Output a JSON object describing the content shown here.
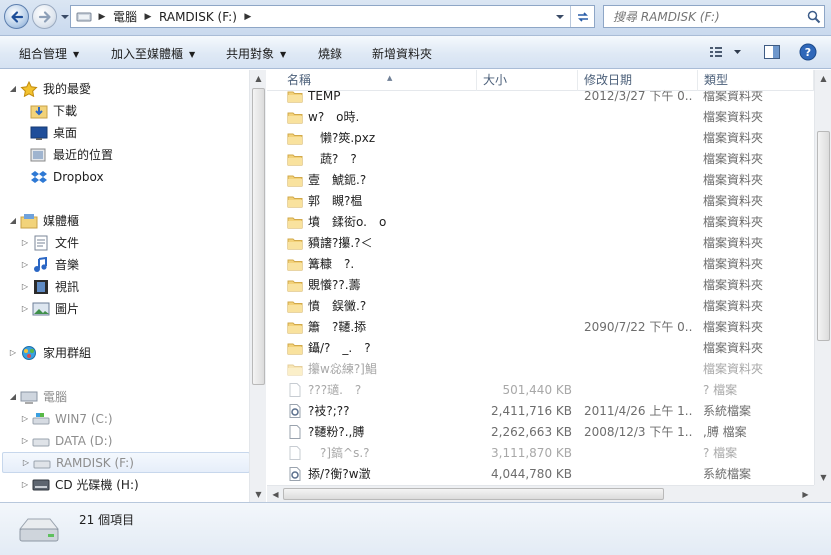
{
  "address": {
    "breadcrumbs": [
      "電腦",
      "RAMDISK (F:)"
    ],
    "search_placeholder": "搜尋 RAMDISK (F:)"
  },
  "toolbar": {
    "organize": "組合管理",
    "add_to_library": "加入至媒體櫃",
    "share_with": "共用對象",
    "burn": "燒錄",
    "new_folder": "新增資料夾"
  },
  "nav": {
    "favorites": {
      "label": "我的最愛",
      "items": [
        "下載",
        "桌面",
        "最近的位置",
        "Dropbox"
      ]
    },
    "libraries": {
      "label": "媒體櫃",
      "items": [
        "文件",
        "音樂",
        "視訊",
        "圖片"
      ]
    },
    "homegroup": {
      "label": "家用群組"
    },
    "computer": {
      "label": "電腦",
      "drives": [
        "WIN7 (C:)",
        "DATA (D:)",
        "RAMDISK (F:)",
        "CD 光碟機 (H:)"
      ]
    }
  },
  "columns": {
    "name": "名稱",
    "size": "大小",
    "date": "修改日期",
    "type": "類型"
  },
  "files": [
    {
      "name": "TEMP",
      "size": "",
      "date": "2012/3/27 下午 0...",
      "type": "檔案資料夾",
      "kind": "folder"
    },
    {
      "name": "w?　o時.",
      "size": "",
      "date": "",
      "type": "檔案資料夾",
      "kind": "folder"
    },
    {
      "name": "　懒?筴.pxz",
      "size": "",
      "date": "",
      "type": "檔案資料夾",
      "kind": "folder"
    },
    {
      "name": "　蔬?　?",
      "size": "",
      "date": "",
      "type": "檔案資料夾",
      "kind": "folder"
    },
    {
      "name": "壹　鯱鈪.?",
      "size": "",
      "date": "",
      "type": "檔案資料夾",
      "kind": "folder"
    },
    {
      "name": "郭　瞡?榅",
      "size": "",
      "date": "",
      "type": "檔案資料夾",
      "kind": "folder"
    },
    {
      "name": "墳　鍒衒o.　o",
      "size": "",
      "date": "",
      "type": "檔案資料夾",
      "kind": "folder"
    },
    {
      "name": "豶譇?攥.?＜",
      "size": "",
      "date": "",
      "type": "檔案資料夾",
      "kind": "folder"
    },
    {
      "name": "篝糠　?.",
      "size": "",
      "date": "",
      "type": "檔案資料夾",
      "kind": "folder"
    },
    {
      "name": "覞懩??.薵",
      "size": "",
      "date": "",
      "type": "檔案資料夾",
      "kind": "folder"
    },
    {
      "name": "憤　鋘黴.?",
      "size": "",
      "date": "",
      "type": "檔案資料夾",
      "kind": "folder"
    },
    {
      "name": "簫　?韆.掭",
      "size": "",
      "date": "2090/7/22 下午 0...",
      "type": "檔案資料夾",
      "kind": "folder"
    },
    {
      "name": "鑷/?　_.　?",
      "size": "",
      "date": "",
      "type": "檔案資料夾",
      "kind": "folder"
    },
    {
      "name": "攥w惢練?]鯧",
      "size": "",
      "date": "",
      "type": "檔案資料夾",
      "kind": "folder",
      "faded": true
    },
    {
      "name": "???瓋.　?",
      "size": "501,440 KB",
      "date": "",
      "type": "? 檔案",
      "kind": "file",
      "faded": true
    },
    {
      "name": "?衼?;??",
      "size": "2,411,716 KB",
      "date": "2011/4/26 上午 1...",
      "type": "系統檔案",
      "kind": "sys"
    },
    {
      "name": "?韆粉?.,膊",
      "size": "2,262,663 KB",
      "date": "2008/12/3 下午 1...",
      "type": ",膊 檔案",
      "kind": "file"
    },
    {
      "name": "　?]鎬^s.?",
      "size": "3,111,870 KB",
      "date": "",
      "type": "? 檔案",
      "kind": "file",
      "faded": true
    },
    {
      "name": "掭/?衡?w澂",
      "size": "4,044,780 KB",
      "date": "",
      "type": "系統檔案",
      "kind": "sys"
    }
  ],
  "status": {
    "item_count": "21 個項目"
  }
}
